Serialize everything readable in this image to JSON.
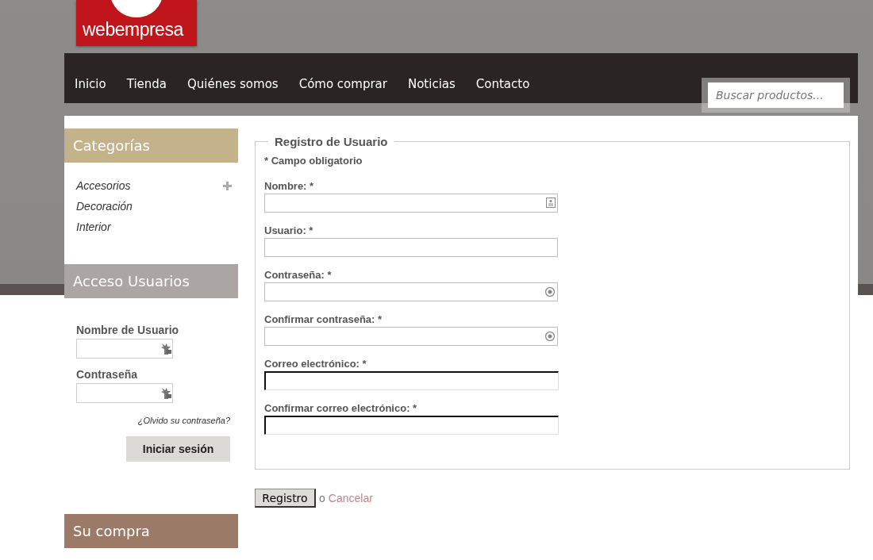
{
  "logo": {
    "text": "webempresa"
  },
  "nav": [
    {
      "label": "Inicio"
    },
    {
      "label": "Tienda"
    },
    {
      "label": "Quiénes somos"
    },
    {
      "label": "Cómo comprar"
    },
    {
      "label": "Noticias"
    },
    {
      "label": "Contacto"
    }
  ],
  "search": {
    "placeholder": "Buscar productos..."
  },
  "sidebar": {
    "categories": {
      "title": "Categorías",
      "items": [
        {
          "label": "Accesorios",
          "expandable": true
        },
        {
          "label": "Decoración",
          "expandable": false
        },
        {
          "label": "Interior",
          "expandable": false
        }
      ]
    },
    "login": {
      "title": "Acceso Usuarios",
      "fields": [
        {
          "label": "Nombre de Usuario"
        },
        {
          "label": "Contraseña"
        }
      ],
      "forgot_link": "¿Olvido su contraseña?",
      "button": "Iniciar sesión"
    },
    "cart": {
      "title": "Su compra"
    }
  },
  "form": {
    "legend": "Registro de Usuario",
    "required_note": "* Campo obligatorio",
    "fields": [
      {
        "label": "Nombre: *",
        "kind": "contact"
      },
      {
        "label": "Usuario: *",
        "kind": "plain"
      },
      {
        "label": "Contraseña: *",
        "kind": "password"
      },
      {
        "label": "Confirmar contraseña: *",
        "kind": "password"
      },
      {
        "label": "Correo electrónico: *",
        "kind": "email"
      },
      {
        "label": "Confirmar correo electrónico: *",
        "kind": "email"
      }
    ],
    "submit": "Registro",
    "separator": "o",
    "cancel": "Cancelar"
  }
}
